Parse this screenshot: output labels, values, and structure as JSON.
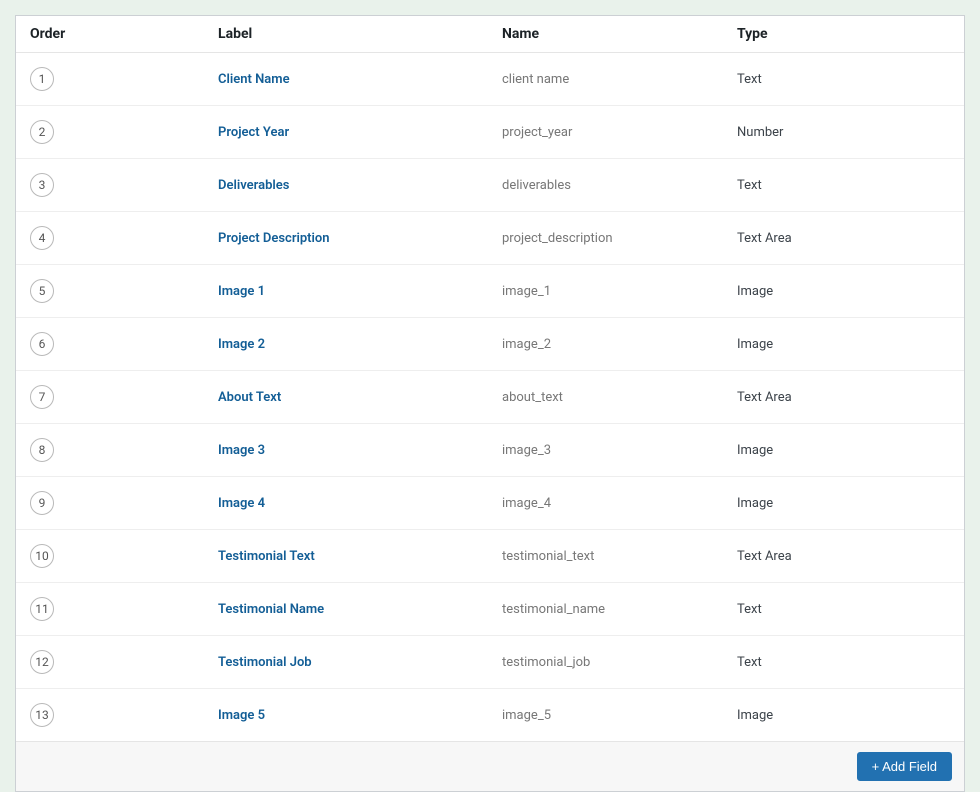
{
  "headers": {
    "order": "Order",
    "label": "Label",
    "name": "Name",
    "type": "Type"
  },
  "rows": [
    {
      "order": "1",
      "label": "Client Name",
      "name": "client name",
      "type": "Text"
    },
    {
      "order": "2",
      "label": "Project Year",
      "name": "project_year",
      "type": "Number"
    },
    {
      "order": "3",
      "label": "Deliverables",
      "name": "deliverables",
      "type": "Text"
    },
    {
      "order": "4",
      "label": "Project Description",
      "name": "project_description",
      "type": "Text Area"
    },
    {
      "order": "5",
      "label": "Image 1",
      "name": "image_1",
      "type": "Image"
    },
    {
      "order": "6",
      "label": "Image 2",
      "name": "image_2",
      "type": "Image"
    },
    {
      "order": "7",
      "label": "About Text",
      "name": "about_text",
      "type": "Text Area"
    },
    {
      "order": "8",
      "label": "Image 3",
      "name": "image_3",
      "type": "Image"
    },
    {
      "order": "9",
      "label": "Image 4",
      "name": "image_4",
      "type": "Image"
    },
    {
      "order": "10",
      "label": "Testimonial Text",
      "name": "testimonial_text",
      "type": "Text Area"
    },
    {
      "order": "11",
      "label": "Testimonial Name",
      "name": "testimonial_name",
      "type": "Text"
    },
    {
      "order": "12",
      "label": "Testimonial Job",
      "name": "testimonial_job",
      "type": "Text"
    },
    {
      "order": "13",
      "label": "Image 5",
      "name": "image_5",
      "type": "Image"
    }
  ],
  "actions": {
    "add_field": "+ Add Field"
  }
}
